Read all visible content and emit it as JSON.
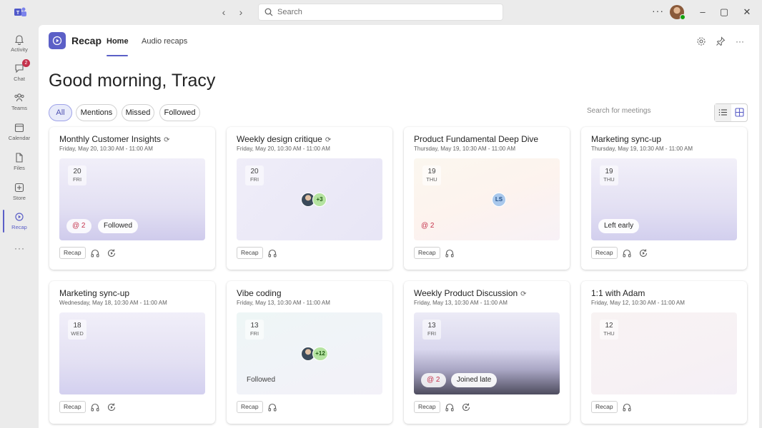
{
  "titlebar": {
    "search_placeholder": "Search",
    "more": "···",
    "avatar_status": "available"
  },
  "rail": {
    "items": [
      {
        "label": "Activity",
        "icon": "bell-icon"
      },
      {
        "label": "Chat",
        "icon": "chat-icon",
        "badge": "2"
      },
      {
        "label": "Teams",
        "icon": "teams-icon"
      },
      {
        "label": "Calendar",
        "icon": "calendar-icon"
      },
      {
        "label": "Files",
        "icon": "file-icon"
      },
      {
        "label": "Store",
        "icon": "store-icon"
      },
      {
        "label": "Recap",
        "icon": "recap-icon",
        "active": true
      }
    ],
    "more": "···"
  },
  "header": {
    "app_name": "Recap",
    "tabs": [
      {
        "label": "Home",
        "active": true
      },
      {
        "label": "Audio recaps",
        "active": false
      }
    ]
  },
  "greeting": "Good morning, Tracy",
  "filters": [
    {
      "label": "All",
      "active": true
    },
    {
      "label": "Mentions",
      "active": false
    },
    {
      "label": "Missed",
      "active": false
    },
    {
      "label": "Followed",
      "active": false
    }
  ],
  "meeting_search_placeholder": "Search for meetings",
  "colors": {
    "accent": "#5b5fc7",
    "mention": "#c4314b"
  },
  "cards": [
    {
      "title": "Monthly Customer Insights",
      "recurring": true,
      "time": "Friday, May 20, 10:30 AM - 11:00 AM",
      "date_num": "20",
      "date_day": "FRI",
      "mentions": "@ 2",
      "pill": "Followed",
      "recap_label": "Recap",
      "has_headphones": true,
      "has_loop": true
    },
    {
      "title": "Weekly design critique",
      "recurring": true,
      "time": "Friday, May 20, 10:30 AM - 11:00 AM",
      "date_num": "20",
      "date_day": "FRI",
      "people_more": "+3",
      "recap_label": "Recap",
      "has_headphones": true,
      "has_loop": false
    },
    {
      "title": "Product Fundamental Deep Dive",
      "recurring": false,
      "time": "Thursday, May 19, 10:30 AM - 11:00 AM",
      "date_num": "19",
      "date_day": "THU",
      "initials": "LS",
      "mentions": "@ 2",
      "recap_label": "Recap",
      "has_headphones": true,
      "has_loop": false
    },
    {
      "title": "Marketing sync-up",
      "recurring": false,
      "time": "Thursday, May 19, 10:30 AM - 11:00 AM",
      "date_num": "19",
      "date_day": "THU",
      "pill": "Left early",
      "recap_label": "Recap",
      "has_headphones": true,
      "has_loop": true
    },
    {
      "title": "Marketing sync-up",
      "recurring": false,
      "time": "Wednesday, May 18, 10:30 AM - 11:00 AM",
      "date_num": "18",
      "date_day": "WED",
      "recap_label": "Recap",
      "has_headphones": true,
      "has_loop": true
    },
    {
      "title": "Vibe coding",
      "recurring": false,
      "time": "Friday, May 13, 10:30 AM - 11:00 AM",
      "date_num": "13",
      "date_day": "FRI",
      "people_more": "+12",
      "plain_label": "Followed",
      "recap_label": "Recap",
      "has_headphones": true,
      "has_loop": false
    },
    {
      "title": "Weekly Product Discussion",
      "recurring": true,
      "time": "Friday, May 13, 10:30 AM - 11:00 AM",
      "date_num": "13",
      "date_day": "FRI",
      "mentions": "@ 2",
      "pill": "Joined late",
      "recap_label": "Recap",
      "has_headphones": true,
      "has_loop": true
    },
    {
      "title": "1:1 with Adam",
      "recurring": false,
      "time": "Friday, May 12, 10:30 AM - 11:00 AM",
      "date_num": "12",
      "date_day": "THU",
      "recap_label": "Recap",
      "has_headphones": true,
      "has_loop": false
    }
  ]
}
